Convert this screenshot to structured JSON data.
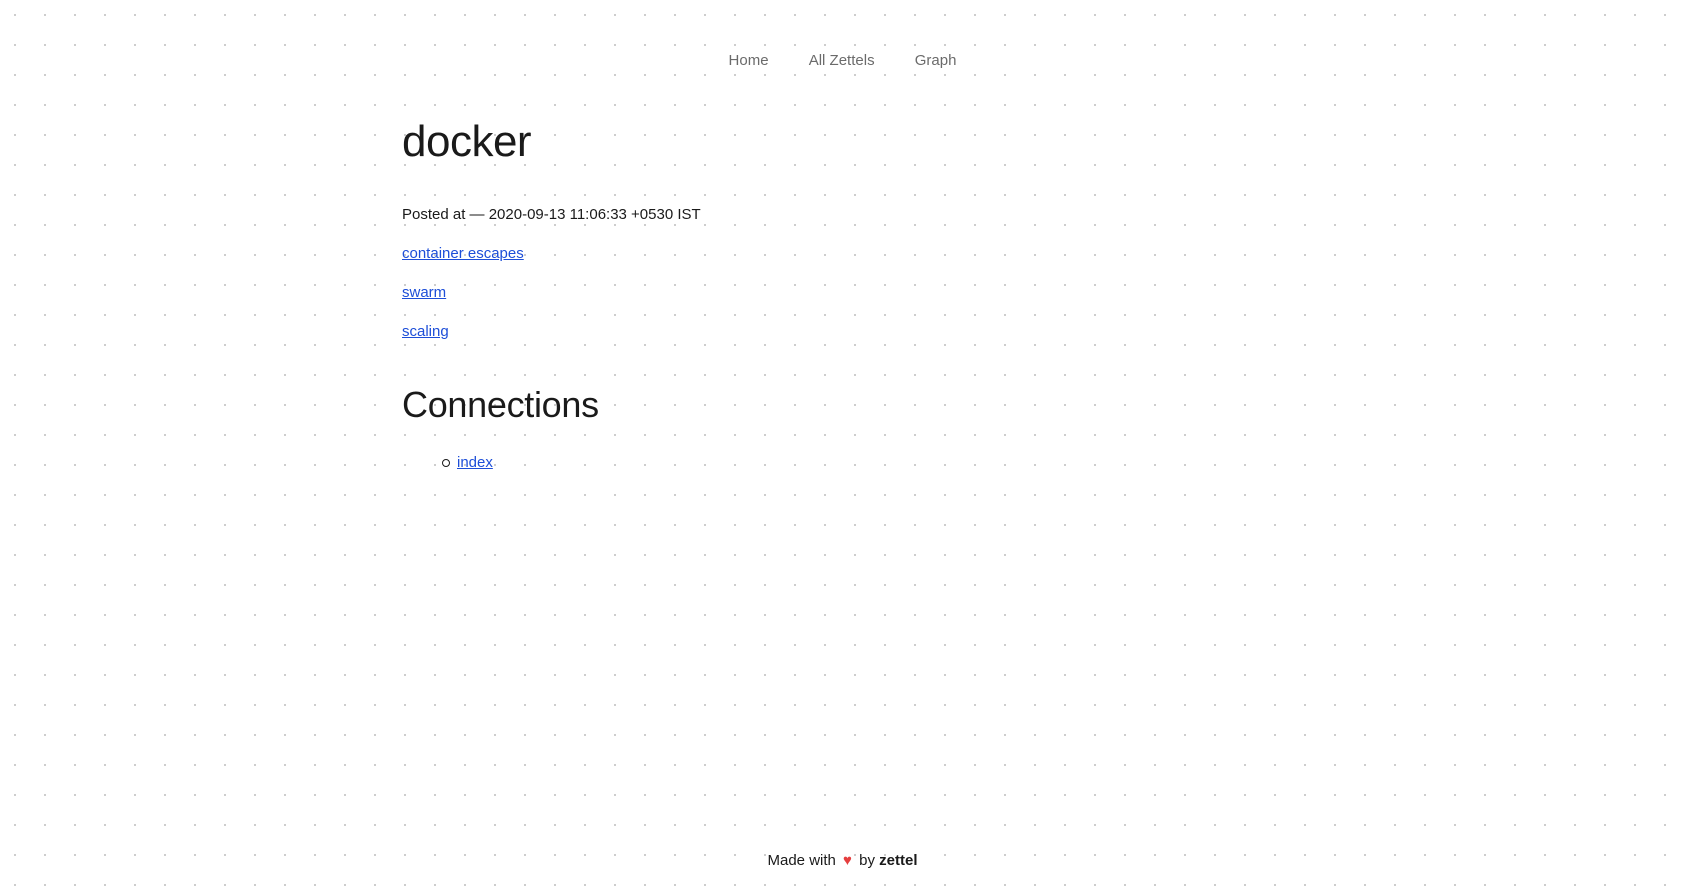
{
  "nav": {
    "items": [
      {
        "label": "Home"
      },
      {
        "label": "All Zettels"
      },
      {
        "label": "Graph"
      }
    ]
  },
  "page": {
    "title": "docker",
    "posted": "Posted at — 2020-09-13 11:06:33 +0530 IST",
    "links": [
      {
        "label": "container escapes"
      },
      {
        "label": "swarm"
      },
      {
        "label": "scaling"
      }
    ]
  },
  "connections": {
    "heading": "Connections",
    "items": [
      {
        "label": "index"
      }
    ]
  },
  "footer": {
    "prefix": "Made with",
    "heart": "♥",
    "by": "by",
    "brand": "zettel"
  },
  "colors": {
    "link": "#1d4ed8",
    "heart": "#e53e3e",
    "nav_text": "#6b6b6b"
  }
}
